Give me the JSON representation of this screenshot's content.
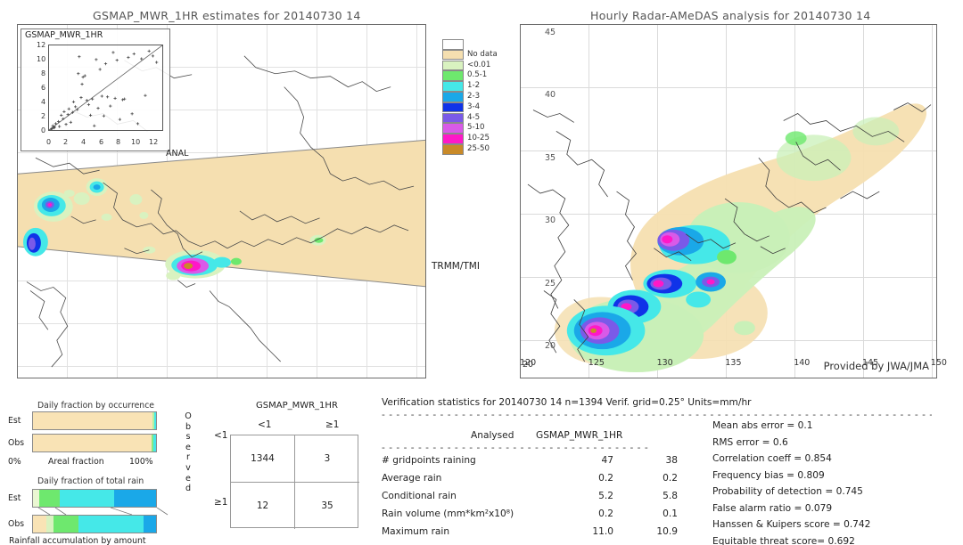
{
  "left_panel": {
    "title": "GSMAP_MWR_1HR estimates for 20140730 14",
    "inset_label": "GSMAP_MWR_1HR",
    "inset_x_ticks": [
      "0",
      "2",
      "4",
      "6",
      "8",
      "10",
      "12"
    ],
    "inset_y_ticks": [
      "0",
      "2",
      "4",
      "6",
      "8",
      "10",
      "12"
    ],
    "anal_label": "ANAL",
    "sensor_label": "TRMM/TMI"
  },
  "right_panel": {
    "title": "Hourly Radar-AMeDAS analysis for 20140730 14",
    "credit": "Provided by JWA/JMA",
    "x_ticks": [
      "120",
      "125",
      "130",
      "135",
      "140",
      "145",
      "150"
    ],
    "y_ticks": [
      "20",
      "25",
      "30",
      "35",
      "40",
      "45"
    ],
    "corner_tick": "20"
  },
  "colorbar": {
    "units": "mm/hr",
    "entries": [
      {
        "label": "",
        "color": "#ffffff"
      },
      {
        "label": "No data",
        "color": "#f5dfb0"
      },
      {
        "label": "<0.01",
        "color": "#d9f2c0"
      },
      {
        "label": "0.5-1",
        "color": "#6ee86e"
      },
      {
        "label": "1-2",
        "color": "#45e8e8"
      },
      {
        "label": "2-3",
        "color": "#1aa8e8"
      },
      {
        "label": "3-4",
        "color": "#1033e8"
      },
      {
        "label": "4-5",
        "color": "#7a5ae8"
      },
      {
        "label": "5-10",
        "color": "#d95ae8"
      },
      {
        "label": "10-25",
        "color": "#ff18c8"
      },
      {
        "label": "25-50",
        "color": "#c98a28"
      }
    ]
  },
  "bar_charts": [
    {
      "title": "Daily fraction by occurrence",
      "axis_label": "Areal fraction",
      "axis_min": "0%",
      "axis_max": "100%",
      "rows": [
        {
          "label": "Est",
          "segments": [
            {
              "color": "#f9e3b5",
              "pct": 97.0
            },
            {
              "color": "#b7f0a0",
              "pct": 1.2
            },
            {
              "color": "#45e8e8",
              "pct": 1.8
            }
          ]
        },
        {
          "label": "Obs",
          "segments": [
            {
              "color": "#f9e3b5",
              "pct": 96.4
            },
            {
              "color": "#8aea82",
              "pct": 1.6
            },
            {
              "color": "#45e8e8",
              "pct": 2.0
            }
          ]
        }
      ]
    },
    {
      "title": "Daily fraction of total rain",
      "axis_label": "Rainfall accumulation by amount",
      "rows": [
        {
          "label": "Est",
          "segments": [
            {
              "color": "#eaf7d2",
              "pct": 5.0
            },
            {
              "color": "#6ee86e",
              "pct": 17.0
            },
            {
              "color": "#45e8e8",
              "pct": 44.0
            },
            {
              "color": "#1aa8e8",
              "pct": 34.0
            }
          ]
        },
        {
          "label": "Obs",
          "segments": [
            {
              "color": "#f9e3b5",
              "pct": 11.0
            },
            {
              "color": "#d9f2c0",
              "pct": 6.0
            },
            {
              "color": "#6ee86e",
              "pct": 20.0
            },
            {
              "color": "#45e8e8",
              "pct": 53.0
            },
            {
              "color": "#1aa8e8",
              "pct": 10.0
            }
          ]
        }
      ]
    }
  ],
  "contingency": {
    "title": "GSMAP_MWR_1HR",
    "col_headers": [
      "<1",
      "≥1"
    ],
    "row_headers": [
      "<1",
      "≥1"
    ],
    "side_label": "Observed",
    "cells": [
      [
        "1344",
        "3"
      ],
      [
        "12",
        "35"
      ]
    ]
  },
  "verification": {
    "header": "Verification statistics for 20140730 14   n=1394   Verif. grid=0.25°   Units=mm/hr",
    "col_headers": [
      "Analysed",
      "GSMAP_MWR_1HR"
    ],
    "rows": [
      {
        "label": "# gridpoints raining",
        "analysed": "47",
        "model": "38"
      },
      {
        "label": "Average rain",
        "analysed": "0.2",
        "model": "0.2"
      },
      {
        "label": "Conditional rain",
        "analysed": "5.2",
        "model": "5.8"
      },
      {
        "label": "Rain volume (mm*km²x10⁸)",
        "analysed": "0.2",
        "model": "0.1"
      },
      {
        "label": "Maximum rain",
        "analysed": "11.0",
        "model": "10.9"
      }
    ],
    "scores": [
      "Mean abs error = 0.1",
      "RMS error = 0.6",
      "Correlation coeff = 0.854",
      "Frequency bias = 0.809",
      "Probability of detection = 0.745",
      "False alarm ratio = 0.079",
      "Hanssen & Kuipers score = 0.742",
      "Equitable threat score= 0.692"
    ]
  },
  "scatter_data": {
    "type": "scatter",
    "xlabel": "GSMAP_MWR_1HR",
    "ylabel": "ANAL",
    "xlim": [
      0,
      12
    ],
    "ylim": [
      0,
      12
    ],
    "reference_line": "1:1",
    "points": [
      [
        0.2,
        0.1
      ],
      [
        0.3,
        0.2
      ],
      [
        0.5,
        0.3
      ],
      [
        0.4,
        0.6
      ],
      [
        0.6,
        0.4
      ],
      [
        0.7,
        0.9
      ],
      [
        1.0,
        1.2
      ],
      [
        1.1,
        0.5
      ],
      [
        1.3,
        2.1
      ],
      [
        1.5,
        1.6
      ],
      [
        1.6,
        2.6
      ],
      [
        1.8,
        0.8
      ],
      [
        2.0,
        2.2
      ],
      [
        2.1,
        3.0
      ],
      [
        2.3,
        1.1
      ],
      [
        2.5,
        2.5
      ],
      [
        2.6,
        4.0
      ],
      [
        2.8,
        3.3
      ],
      [
        3.0,
        2.9
      ],
      [
        3.1,
        8.0
      ],
      [
        3.2,
        10.4
      ],
      [
        3.4,
        4.6
      ],
      [
        3.5,
        6.5
      ],
      [
        3.6,
        7.5
      ],
      [
        3.8,
        7.7
      ],
      [
        4.0,
        4.2
      ],
      [
        4.2,
        3.6
      ],
      [
        4.4,
        2.1
      ],
      [
        4.6,
        4.4
      ],
      [
        4.8,
        0.6
      ],
      [
        5.0,
        10.0
      ],
      [
        5.2,
        3.1
      ],
      [
        5.4,
        8.6
      ],
      [
        5.6,
        4.8
      ],
      [
        5.8,
        2.0
      ],
      [
        6.0,
        9.4
      ],
      [
        6.2,
        4.7
      ],
      [
        6.5,
        3.4
      ],
      [
        6.8,
        11.0
      ],
      [
        7.0,
        4.5
      ],
      [
        7.2,
        9.9
      ],
      [
        7.5,
        1.5
      ],
      [
        7.8,
        4.3
      ],
      [
        8.0,
        4.4
      ],
      [
        8.4,
        10.3
      ],
      [
        8.8,
        2.3
      ],
      [
        9.0,
        10.8
      ],
      [
        9.4,
        0.9
      ],
      [
        9.8,
        10.1
      ],
      [
        10.2,
        4.9
      ],
      [
        10.6,
        11.2
      ],
      [
        11.0,
        10.5
      ],
      [
        11.4,
        9.6
      ]
    ]
  }
}
